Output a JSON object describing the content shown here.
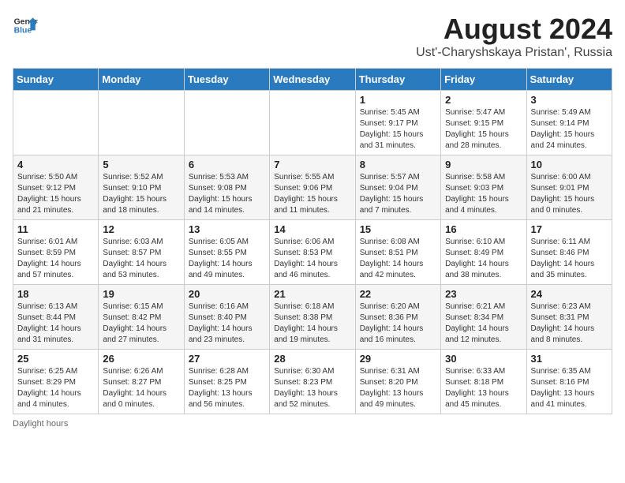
{
  "logo": {
    "general": "General",
    "blue": "Blue"
  },
  "title": "August 2024",
  "subtitle": "Ust'-Charyshskaya Pristan', Russia",
  "footer": "Daylight hours",
  "headers": [
    "Sunday",
    "Monday",
    "Tuesday",
    "Wednesday",
    "Thursday",
    "Friday",
    "Saturday"
  ],
  "weeks": [
    [
      {
        "day": "",
        "sunrise": "",
        "sunset": "",
        "daylight": ""
      },
      {
        "day": "",
        "sunrise": "",
        "sunset": "",
        "daylight": ""
      },
      {
        "day": "",
        "sunrise": "",
        "sunset": "",
        "daylight": ""
      },
      {
        "day": "",
        "sunrise": "",
        "sunset": "",
        "daylight": ""
      },
      {
        "day": "1",
        "sunrise": "Sunrise: 5:45 AM",
        "sunset": "Sunset: 9:17 PM",
        "daylight": "Daylight: 15 hours and 31 minutes."
      },
      {
        "day": "2",
        "sunrise": "Sunrise: 5:47 AM",
        "sunset": "Sunset: 9:15 PM",
        "daylight": "Daylight: 15 hours and 28 minutes."
      },
      {
        "day": "3",
        "sunrise": "Sunrise: 5:49 AM",
        "sunset": "Sunset: 9:14 PM",
        "daylight": "Daylight: 15 hours and 24 minutes."
      }
    ],
    [
      {
        "day": "4",
        "sunrise": "Sunrise: 5:50 AM",
        "sunset": "Sunset: 9:12 PM",
        "daylight": "Daylight: 15 hours and 21 minutes."
      },
      {
        "day": "5",
        "sunrise": "Sunrise: 5:52 AM",
        "sunset": "Sunset: 9:10 PM",
        "daylight": "Daylight: 15 hours and 18 minutes."
      },
      {
        "day": "6",
        "sunrise": "Sunrise: 5:53 AM",
        "sunset": "Sunset: 9:08 PM",
        "daylight": "Daylight: 15 hours and 14 minutes."
      },
      {
        "day": "7",
        "sunrise": "Sunrise: 5:55 AM",
        "sunset": "Sunset: 9:06 PM",
        "daylight": "Daylight: 15 hours and 11 minutes."
      },
      {
        "day": "8",
        "sunrise": "Sunrise: 5:57 AM",
        "sunset": "Sunset: 9:04 PM",
        "daylight": "Daylight: 15 hours and 7 minutes."
      },
      {
        "day": "9",
        "sunrise": "Sunrise: 5:58 AM",
        "sunset": "Sunset: 9:03 PM",
        "daylight": "Daylight: 15 hours and 4 minutes."
      },
      {
        "day": "10",
        "sunrise": "Sunrise: 6:00 AM",
        "sunset": "Sunset: 9:01 PM",
        "daylight": "Daylight: 15 hours and 0 minutes."
      }
    ],
    [
      {
        "day": "11",
        "sunrise": "Sunrise: 6:01 AM",
        "sunset": "Sunset: 8:59 PM",
        "daylight": "Daylight: 14 hours and 57 minutes."
      },
      {
        "day": "12",
        "sunrise": "Sunrise: 6:03 AM",
        "sunset": "Sunset: 8:57 PM",
        "daylight": "Daylight: 14 hours and 53 minutes."
      },
      {
        "day": "13",
        "sunrise": "Sunrise: 6:05 AM",
        "sunset": "Sunset: 8:55 PM",
        "daylight": "Daylight: 14 hours and 49 minutes."
      },
      {
        "day": "14",
        "sunrise": "Sunrise: 6:06 AM",
        "sunset": "Sunset: 8:53 PM",
        "daylight": "Daylight: 14 hours and 46 minutes."
      },
      {
        "day": "15",
        "sunrise": "Sunrise: 6:08 AM",
        "sunset": "Sunset: 8:51 PM",
        "daylight": "Daylight: 14 hours and 42 minutes."
      },
      {
        "day": "16",
        "sunrise": "Sunrise: 6:10 AM",
        "sunset": "Sunset: 8:49 PM",
        "daylight": "Daylight: 14 hours and 38 minutes."
      },
      {
        "day": "17",
        "sunrise": "Sunrise: 6:11 AM",
        "sunset": "Sunset: 8:46 PM",
        "daylight": "Daylight: 14 hours and 35 minutes."
      }
    ],
    [
      {
        "day": "18",
        "sunrise": "Sunrise: 6:13 AM",
        "sunset": "Sunset: 8:44 PM",
        "daylight": "Daylight: 14 hours and 31 minutes."
      },
      {
        "day": "19",
        "sunrise": "Sunrise: 6:15 AM",
        "sunset": "Sunset: 8:42 PM",
        "daylight": "Daylight: 14 hours and 27 minutes."
      },
      {
        "day": "20",
        "sunrise": "Sunrise: 6:16 AM",
        "sunset": "Sunset: 8:40 PM",
        "daylight": "Daylight: 14 hours and 23 minutes."
      },
      {
        "day": "21",
        "sunrise": "Sunrise: 6:18 AM",
        "sunset": "Sunset: 8:38 PM",
        "daylight": "Daylight: 14 hours and 19 minutes."
      },
      {
        "day": "22",
        "sunrise": "Sunrise: 6:20 AM",
        "sunset": "Sunset: 8:36 PM",
        "daylight": "Daylight: 14 hours and 16 minutes."
      },
      {
        "day": "23",
        "sunrise": "Sunrise: 6:21 AM",
        "sunset": "Sunset: 8:34 PM",
        "daylight": "Daylight: 14 hours and 12 minutes."
      },
      {
        "day": "24",
        "sunrise": "Sunrise: 6:23 AM",
        "sunset": "Sunset: 8:31 PM",
        "daylight": "Daylight: 14 hours and 8 minutes."
      }
    ],
    [
      {
        "day": "25",
        "sunrise": "Sunrise: 6:25 AM",
        "sunset": "Sunset: 8:29 PM",
        "daylight": "Daylight: 14 hours and 4 minutes."
      },
      {
        "day": "26",
        "sunrise": "Sunrise: 6:26 AM",
        "sunset": "Sunset: 8:27 PM",
        "daylight": "Daylight: 14 hours and 0 minutes."
      },
      {
        "day": "27",
        "sunrise": "Sunrise: 6:28 AM",
        "sunset": "Sunset: 8:25 PM",
        "daylight": "Daylight: 13 hours and 56 minutes."
      },
      {
        "day": "28",
        "sunrise": "Sunrise: 6:30 AM",
        "sunset": "Sunset: 8:23 PM",
        "daylight": "Daylight: 13 hours and 52 minutes."
      },
      {
        "day": "29",
        "sunrise": "Sunrise: 6:31 AM",
        "sunset": "Sunset: 8:20 PM",
        "daylight": "Daylight: 13 hours and 49 minutes."
      },
      {
        "day": "30",
        "sunrise": "Sunrise: 6:33 AM",
        "sunset": "Sunset: 8:18 PM",
        "daylight": "Daylight: 13 hours and 45 minutes."
      },
      {
        "day": "31",
        "sunrise": "Sunrise: 6:35 AM",
        "sunset": "Sunset: 8:16 PM",
        "daylight": "Daylight: 13 hours and 41 minutes."
      }
    ]
  ]
}
